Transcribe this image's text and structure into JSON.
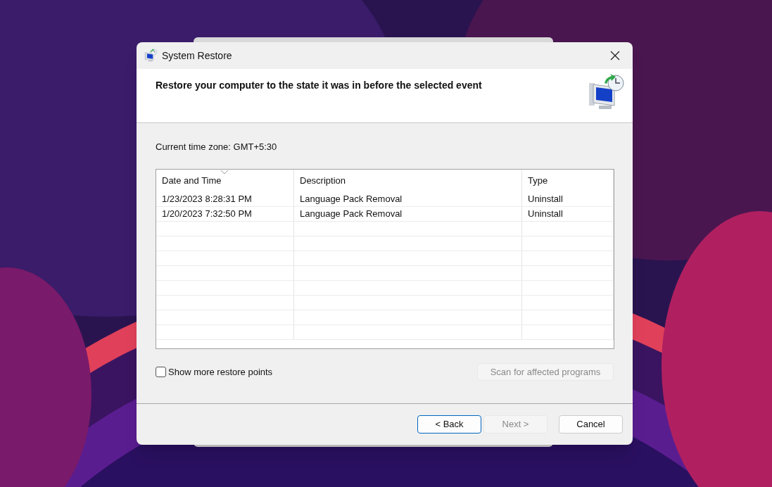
{
  "window": {
    "title": "System Restore"
  },
  "header": {
    "heading": "Restore your computer to the state it was in before the selected event"
  },
  "time_zone": "Current time zone: GMT+5:30",
  "table": {
    "columns": [
      {
        "label": "Date and Time",
        "sorted": true
      },
      {
        "label": "Description",
        "sorted": false
      },
      {
        "label": "Type",
        "sorted": false
      }
    ],
    "rows": [
      {
        "cells": [
          "1/23/2023 8:28:31 PM",
          "Language Pack Removal",
          "Uninstall"
        ],
        "selected": false
      },
      {
        "cells": [
          "1/20/2023 7:32:50 PM",
          "Language Pack Removal",
          "Uninstall"
        ],
        "selected": false
      }
    ]
  },
  "show_more": {
    "label": "Show more restore points",
    "checked": false
  },
  "scan_button": {
    "label": "Scan for affected programs",
    "disabled": true
  },
  "buttons": [
    {
      "label": "< Back",
      "disabled": false,
      "focused": true
    },
    {
      "label": "Next >",
      "disabled": true,
      "focused": false
    },
    {
      "label": "Cancel",
      "disabled": false,
      "focused": false
    }
  ]
}
